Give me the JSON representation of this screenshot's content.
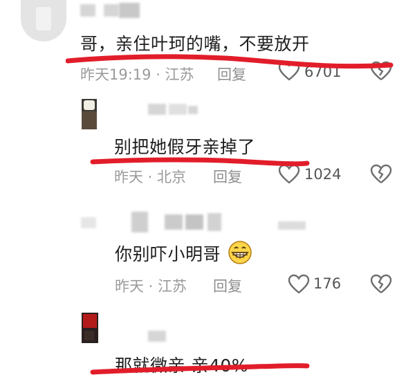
{
  "comments": [
    {
      "text": "哥，亲住叶珂的嘴，不要放开",
      "meta": "昨天19:19 · 江苏",
      "reply": "回复",
      "likes": "6701"
    },
    {
      "text": "别把她假牙亲掉了",
      "meta": "昨天 · 北京",
      "reply": "回复",
      "likes": "1024"
    },
    {
      "text": "你别吓小明哥",
      "meta": "昨天 · 江苏",
      "reply": "回复",
      "likes": "176",
      "emoji": "grinning-face-emoji"
    },
    {
      "text": "那就微亲 亲40%"
    }
  ],
  "colors": {
    "redline": "#e21d2a",
    "meta": "#9a9a9a",
    "text": "#1e1e1e"
  },
  "icons": [
    "heart-outline-icon",
    "broken-heart-icon"
  ]
}
